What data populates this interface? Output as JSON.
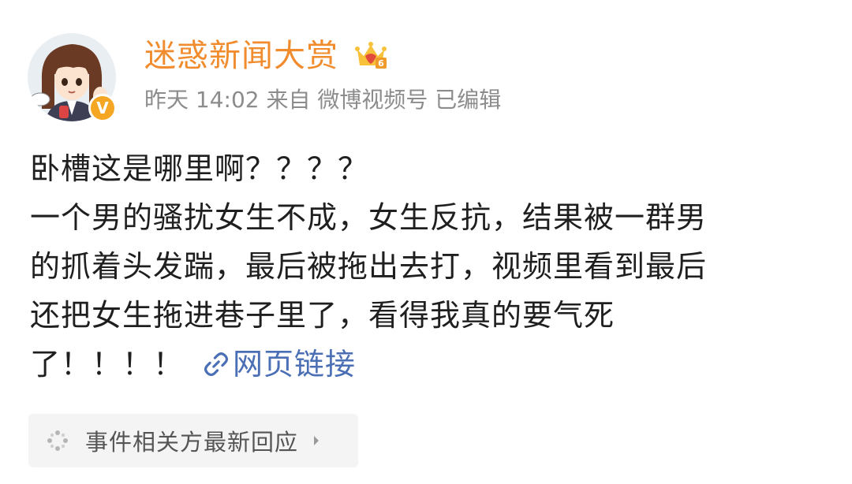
{
  "post": {
    "author": {
      "name": "迷惑新闻大赏",
      "verified_badge": "V",
      "vip_icon": "crown-vip-icon"
    },
    "meta": "昨天 14:02 来自 微博视频号 已编辑",
    "body_lines": [
      "卧槽这是哪里啊？？？？",
      "一个男的骚扰女生不成，女生反抗，结果被一群男",
      "的抓着头发踹，最后被拖出去打，视频里看到最后",
      "还把女生拖进巷子里了，看得我真的要气死",
      "了！！！！"
    ],
    "link_label": "网页链接",
    "event_box": {
      "label": "事件相关方最新回应"
    }
  },
  "colors": {
    "username": "#f18c2e",
    "meta": "#8c8c8c",
    "link": "#4a6fb5",
    "verified": "#f5a623",
    "event_bg": "#f4f4f4"
  }
}
